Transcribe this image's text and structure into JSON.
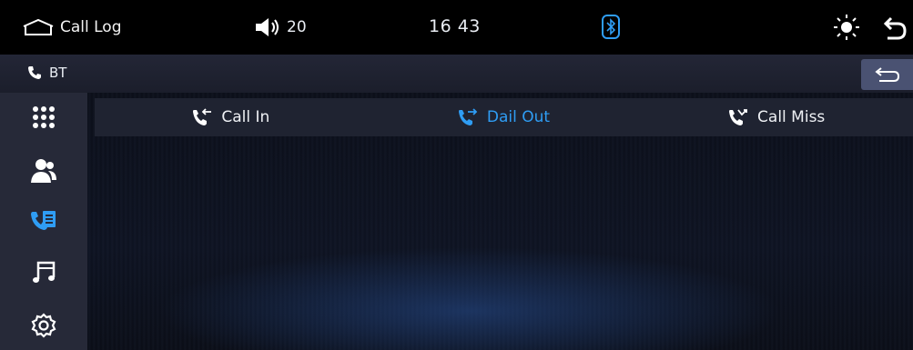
{
  "statusbar": {
    "title": "Call Log",
    "volume": "20",
    "time": "16 43"
  },
  "btbar": {
    "label": "BT"
  },
  "tabs": [
    {
      "label": "Call In",
      "active": false
    },
    {
      "label": "Dail Out",
      "active": true
    },
    {
      "label": "Call Miss",
      "active": false
    }
  ],
  "sidebar": {
    "items": [
      {
        "icon": "dialpad-icon"
      },
      {
        "icon": "contacts-icon"
      },
      {
        "icon": "call-log-icon",
        "active": true
      },
      {
        "icon": "music-icon"
      },
      {
        "icon": "settings-icon"
      }
    ]
  },
  "colors": {
    "accent": "#2f9df4",
    "sidebar": "#262938",
    "tabbar": "#1f2331",
    "return_button": "#4a5272"
  }
}
